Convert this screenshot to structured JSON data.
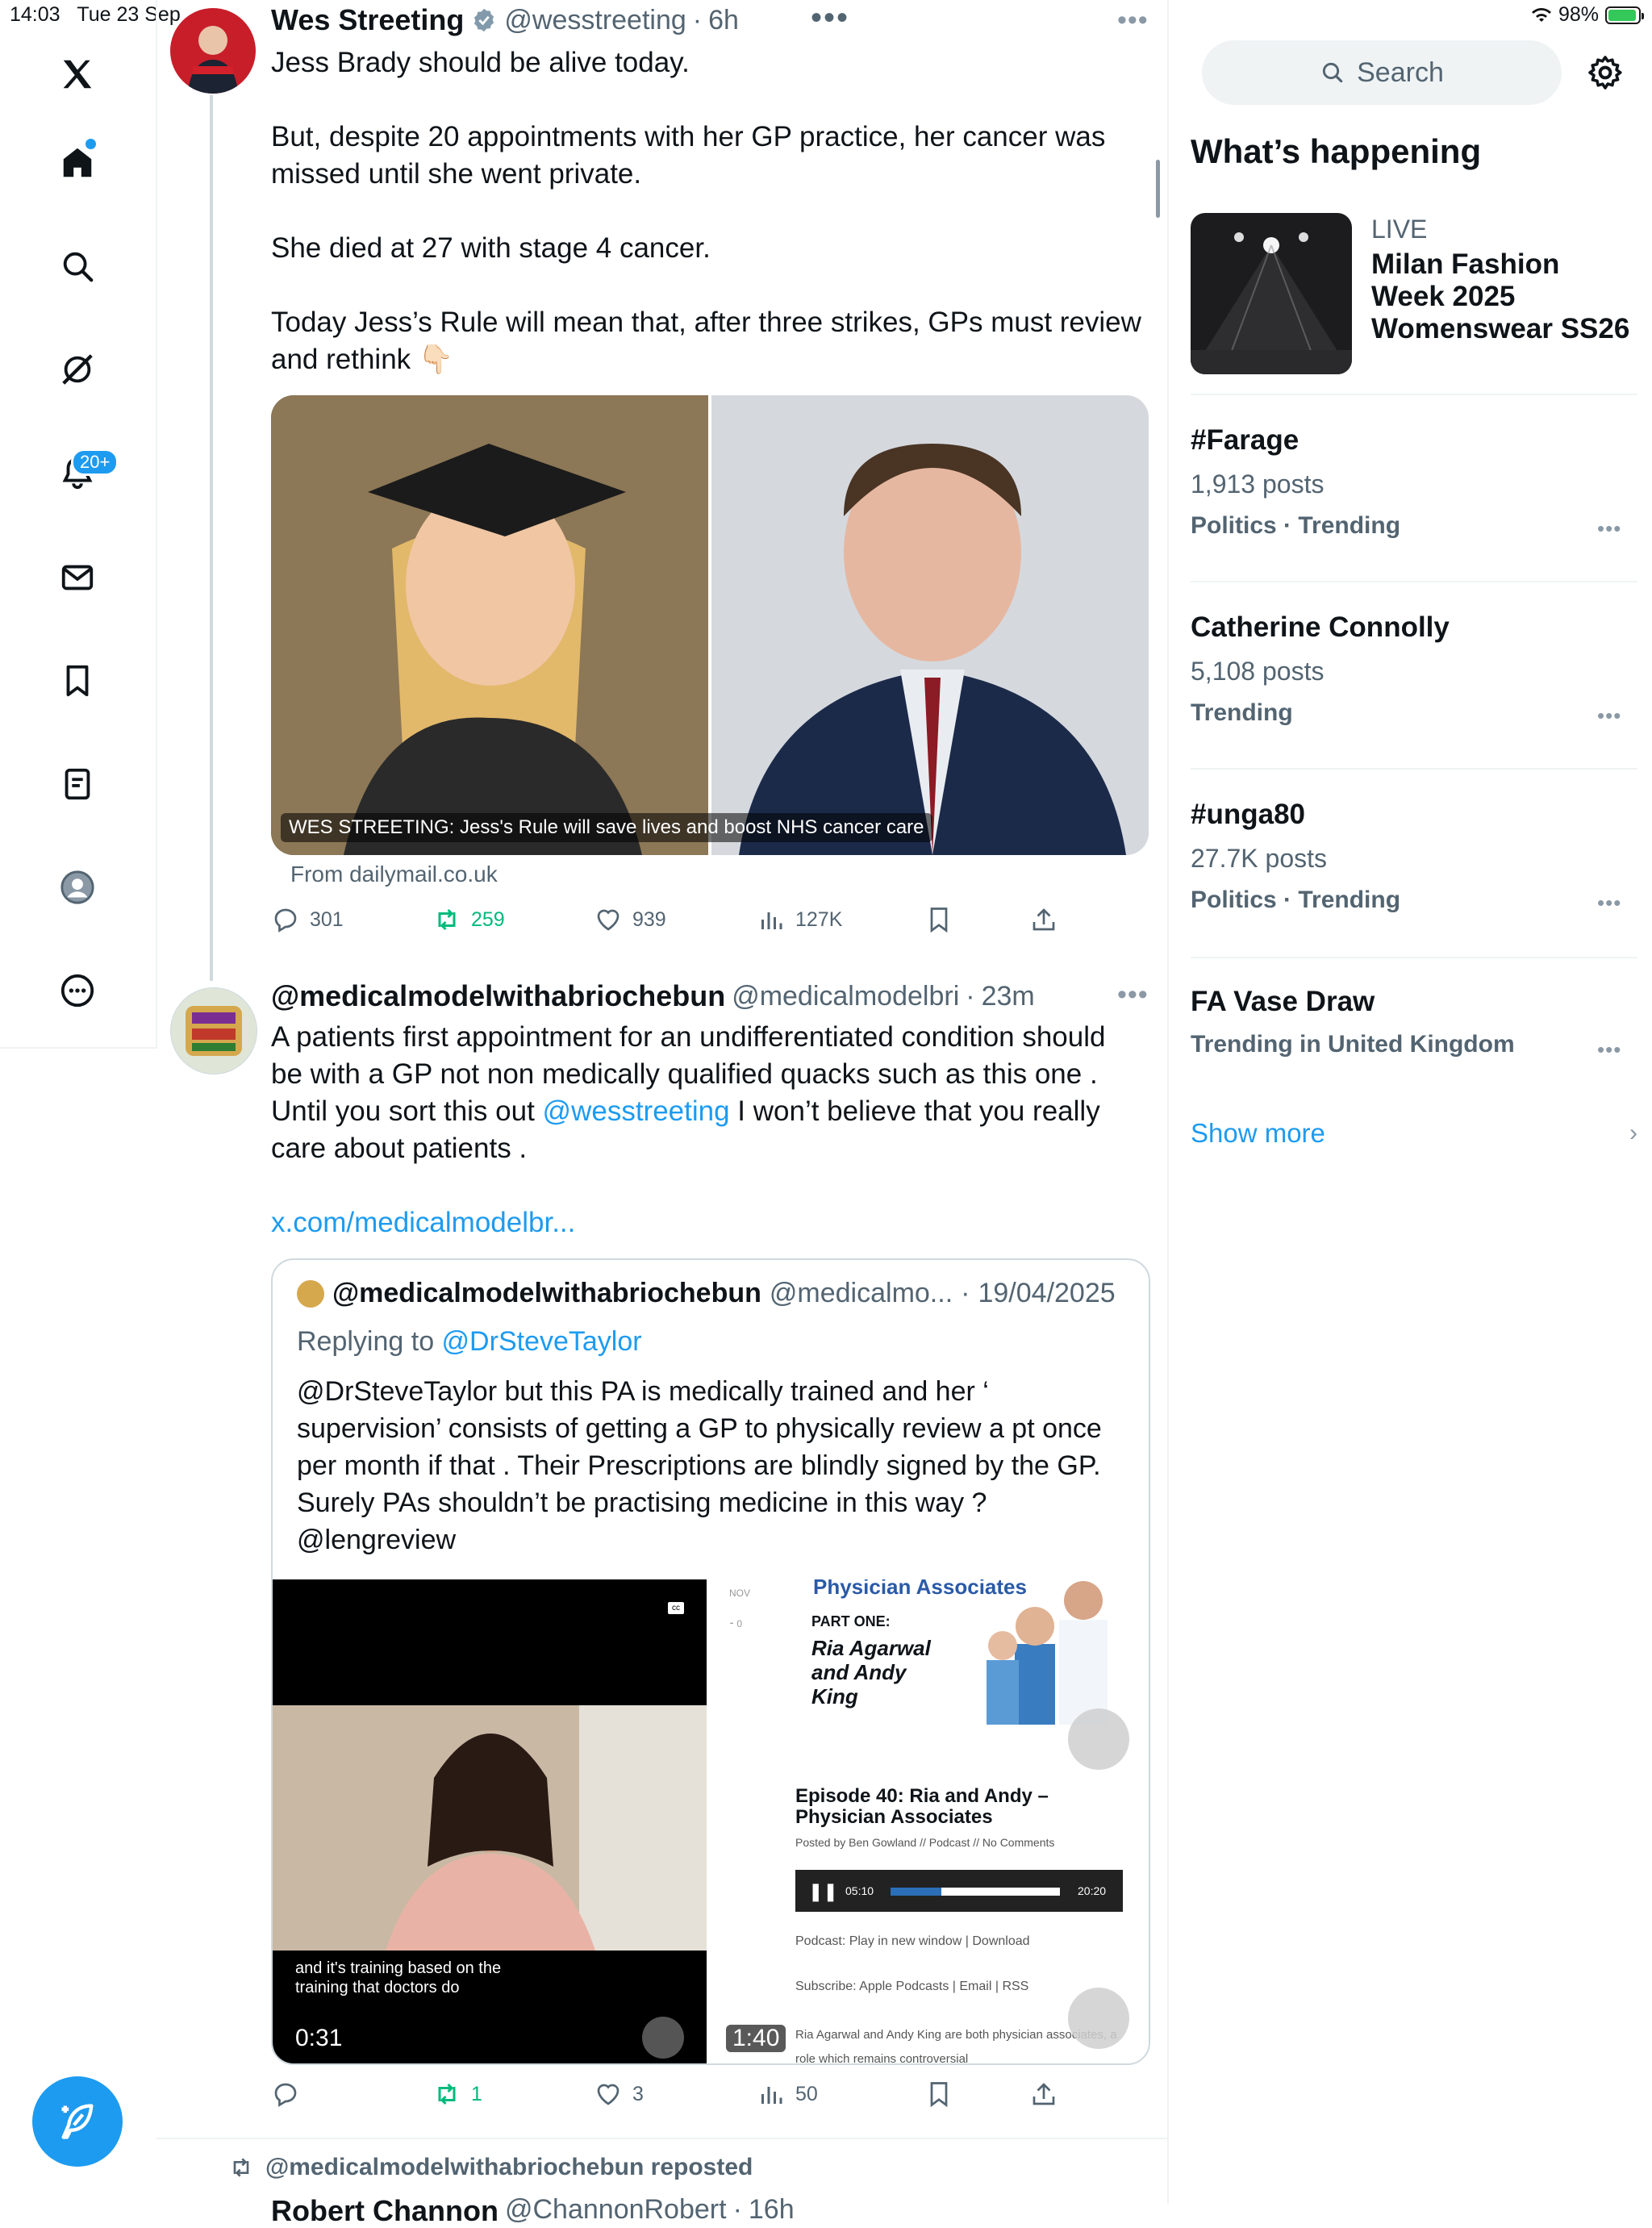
{
  "status_bar": {
    "time": "14:03",
    "date": "Tue 23 Sep",
    "battery": "98%"
  },
  "nav": {
    "notifications_badge": "20+",
    "items": [
      "home-icon",
      "search-icon",
      "grok-icon",
      "notifications-icon",
      "messages-icon",
      "bookmarks-icon",
      "lists-icon",
      "profile-icon",
      "more-icon"
    ]
  },
  "tweet1": {
    "name": "Wes Streeting",
    "handle": "@wesstreeting",
    "time": "6h",
    "text": [
      "Jess Brady should be alive today.",
      "But, despite 20 appointments with her GP practice, her cancer was missed until she went private.",
      "She died at 27 with stage 4 cancer.",
      "Today Jess’s Rule will mean that, after three strikes, GPs must review and rethink 👇🏻"
    ],
    "card_caption": "WES STREETING: Jess's Rule will save lives and boost NHS cancer care",
    "card_source": "From dailymail.co.uk",
    "replies": "301",
    "reposts": "259",
    "likes": "939",
    "views": "127K"
  },
  "tweet2": {
    "name": "@medicalmodelwithabriochebun",
    "handle": "@medicalmodelbri",
    "time": "23m",
    "text_part1": "A patients first appointment for an undifferentiated condition should be with a GP not non medically qualified quacks such as this one . Until you sort this out ",
    "mention": "@wesstreeting",
    "text_part2": " I won’t believe that you really care about patients .",
    "link": "x.com/medicalmodelbr...",
    "quote": {
      "name": "@medicalmodelwithabriochebun",
      "handle": "@medicalmo...",
      "date": "19/04/2025",
      "replying_label": "Replying to ",
      "replying_to": "@DrSteveTaylor",
      "text": "@DrSteveTaylor but this PA is medically trained and her ‘ supervision’ consists of getting a GP to physically review a pt once per month if that . Their Prescriptions are blindly signed by the GP. Surely PAs shouldn’t be practising medicine in this way ? @lengreview",
      "video1_subtitle": "and it's training based on the training that doctors do",
      "video1_duration": "0:31",
      "video1_cc": "cc",
      "video2_duration": "1:40",
      "video2": {
        "header": "Physician Associates",
        "month": "NOV",
        "part": "PART ONE:",
        "names": "Ria Agarwal and Andy King",
        "episode": "Episode 40: Ria and Andy – Physician Associates",
        "posted": "Posted by Ben Gowland // Podcast // No Comments",
        "player_elapsed": "05:10",
        "player_total": "20:20",
        "podcast_line": "Podcast: Play in new window | Download",
        "subscribe_line": "Subscribe: Apple Podcasts | Email | RSS",
        "footer": "Ria Agarwal and Andy King are both physician associates, a role which remains controversial"
      }
    },
    "replies": "",
    "reposts": "1",
    "likes": "3",
    "views": "50"
  },
  "repost_row": {
    "label": "@medicalmodelwithabriochebun reposted",
    "next_name": "Robert Channon",
    "next_handle": "@ChannonRobert",
    "next_time": "16h"
  },
  "sidebar": {
    "search_placeholder": "Search",
    "heading": "What’s happening",
    "live": {
      "label": "LIVE",
      "title": "Milan Fashion Week 2025 Womenswear SS26"
    },
    "trends": [
      {
        "name": "#Farage",
        "posts": "1,913 posts",
        "meta": "Politics · Trending"
      },
      {
        "name": "Catherine Connolly",
        "posts": "5,108 posts",
        "meta": "Trending"
      },
      {
        "name": "#unga80",
        "posts": "27.7K posts",
        "meta": "Politics · Trending"
      },
      {
        "name": "FA Vase Draw",
        "posts": "",
        "meta": "Trending in United Kingdom"
      }
    ],
    "show_more": "Show more"
  },
  "colors": {
    "accent": "#1d9bf0",
    "repost_green": "#00ba7c",
    "muted": "#536471"
  }
}
